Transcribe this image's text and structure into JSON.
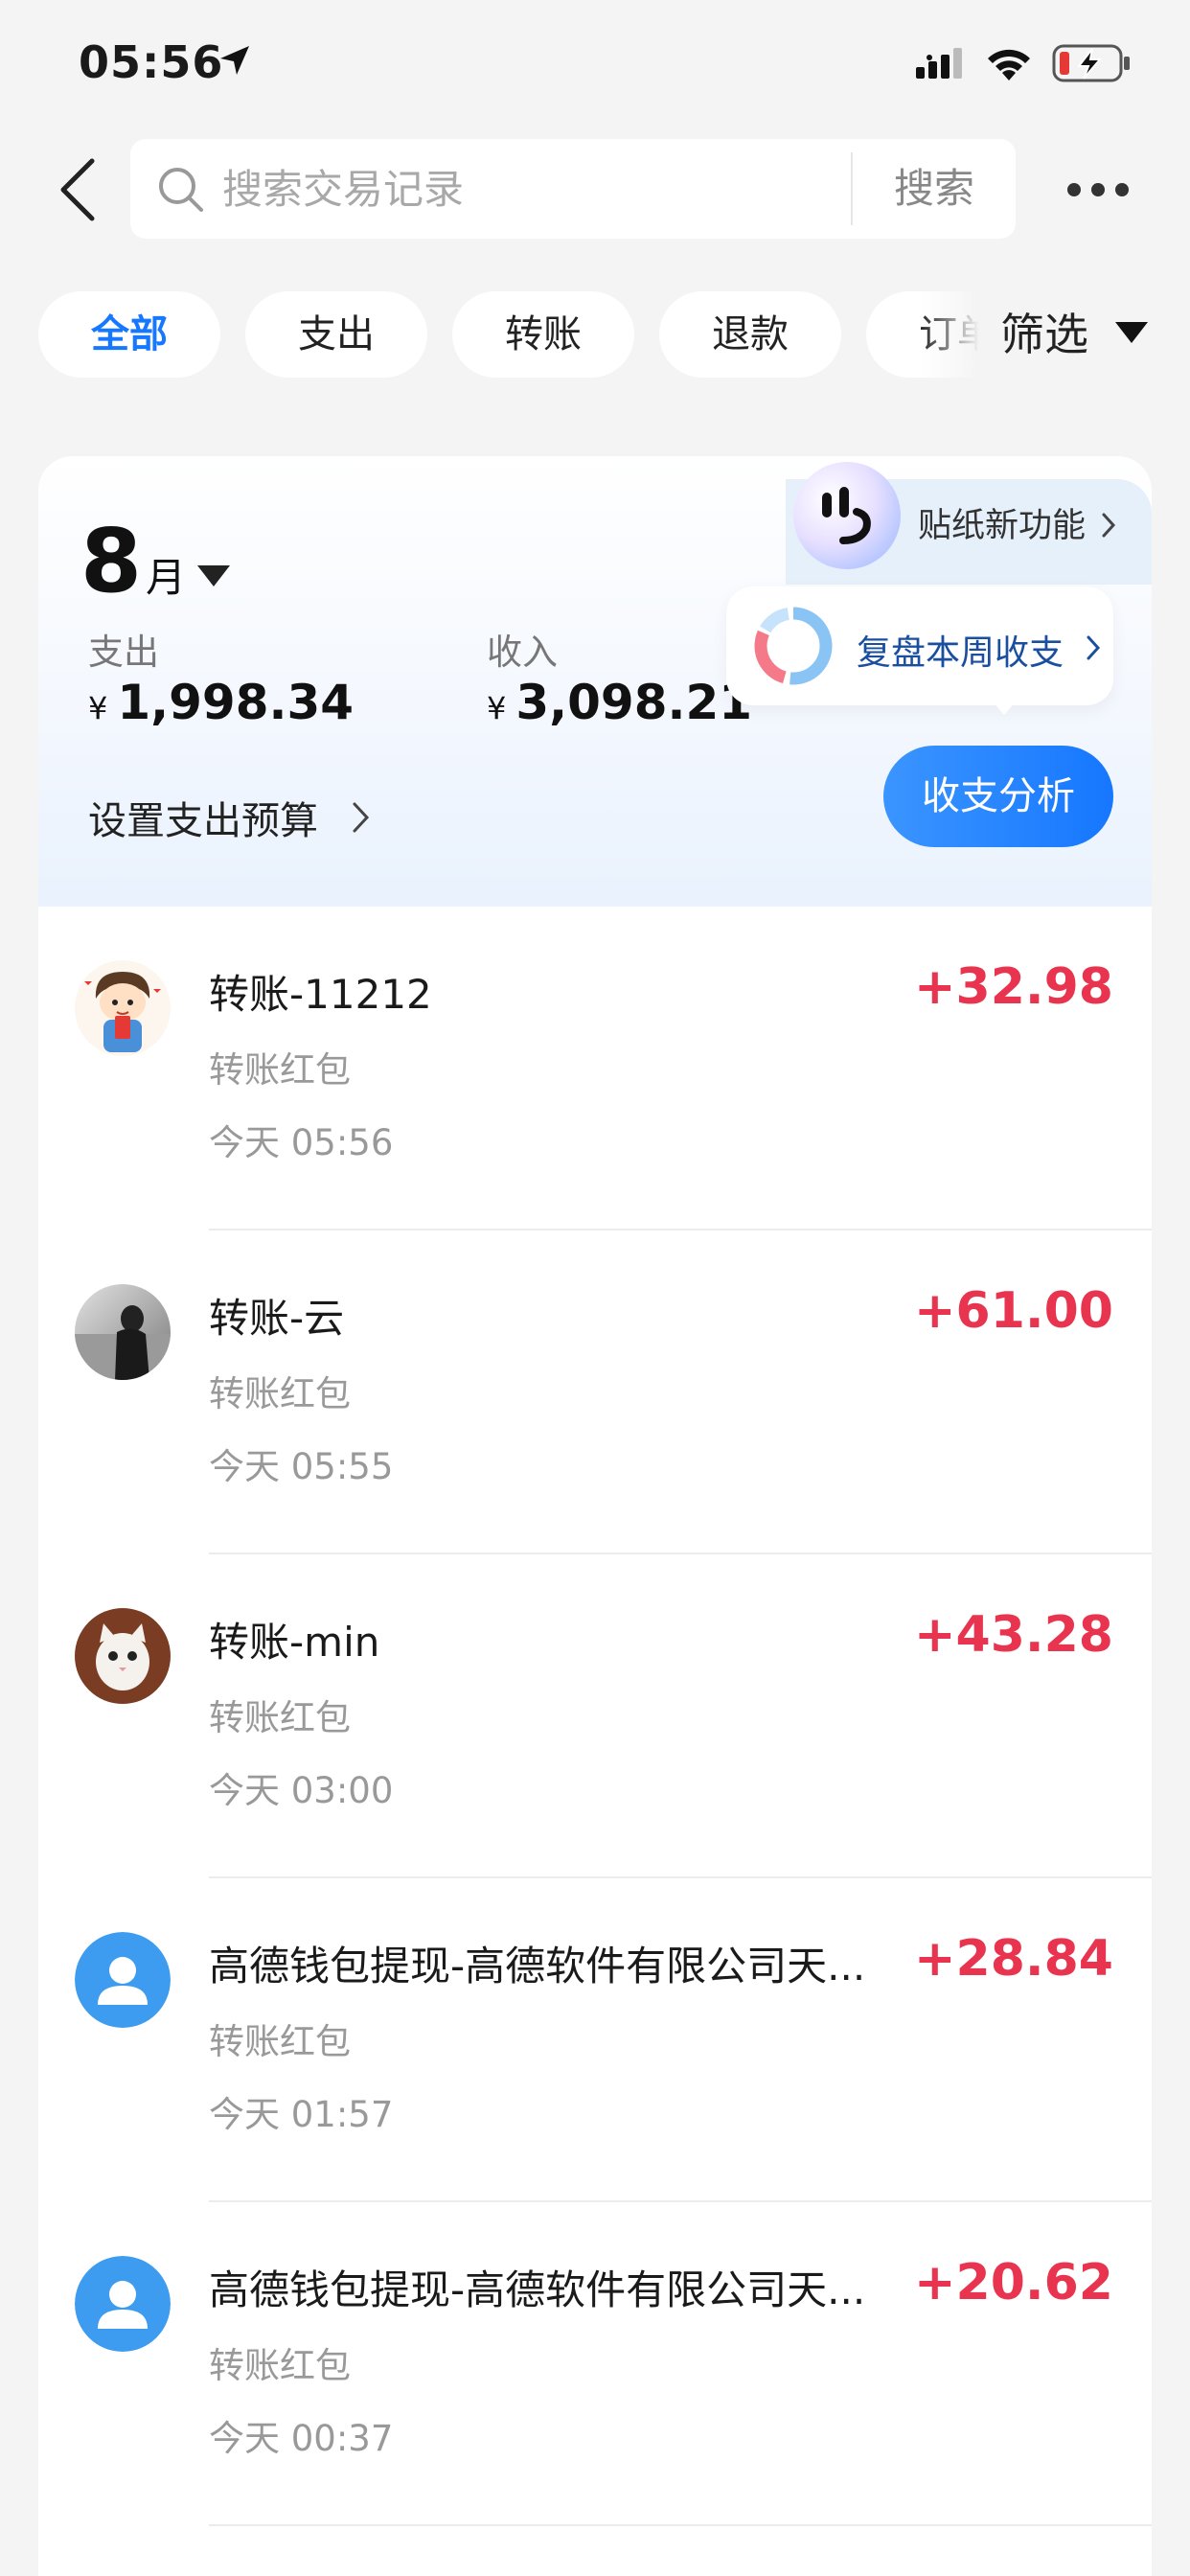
{
  "status_bar": {
    "time": "05:56"
  },
  "header": {
    "search_placeholder": "搜索交易记录",
    "search_button": "搜索"
  },
  "tabs": [
    {
      "label": "全部",
      "active": true
    },
    {
      "label": "支出",
      "active": false
    },
    {
      "label": "转账",
      "active": false
    },
    {
      "label": "退款",
      "active": false
    },
    {
      "label": "订单",
      "active": false
    }
  ],
  "filter_label": "筛选",
  "summary": {
    "month_number": "8",
    "month_unit": "月",
    "expense_label": "支出",
    "expense_currency": "¥",
    "expense_value": "1,998.34",
    "income_label": "收入",
    "income_currency": "¥",
    "income_value": "3,098.21",
    "budget_link": "设置支出预算",
    "sticker_label": "贴纸新功能",
    "review_label": "复盘本周收支",
    "analysis_button": "收支分析"
  },
  "transactions": [
    {
      "title": "转账-11212",
      "subtitle": "转账红包",
      "time": "今天 05:56",
      "amount": "+32.98",
      "avatar": "cartoon-avatar"
    },
    {
      "title": "转账-云",
      "subtitle": "转账红包",
      "time": "今天 05:55",
      "amount": "+61.00",
      "avatar": "photo-avatar"
    },
    {
      "title": "转账-min",
      "subtitle": "转账红包",
      "time": "今天 03:00",
      "amount": "+43.28",
      "avatar": "cat-avatar"
    },
    {
      "title": "高德钱包提现-高德软件有限公司天...",
      "subtitle": "转账红包",
      "time": "今天 01:57",
      "amount": "+28.84",
      "avatar": "default-user-avatar"
    },
    {
      "title": "高德钱包提现-高德软件有限公司天...",
      "subtitle": "转账红包",
      "time": "今天 00:37",
      "amount": "+20.62",
      "avatar": "default-user-avatar"
    }
  ],
  "colors": {
    "accent": "#1677ff",
    "income_amount": "#e8344e",
    "background": "#f4f4f4"
  }
}
